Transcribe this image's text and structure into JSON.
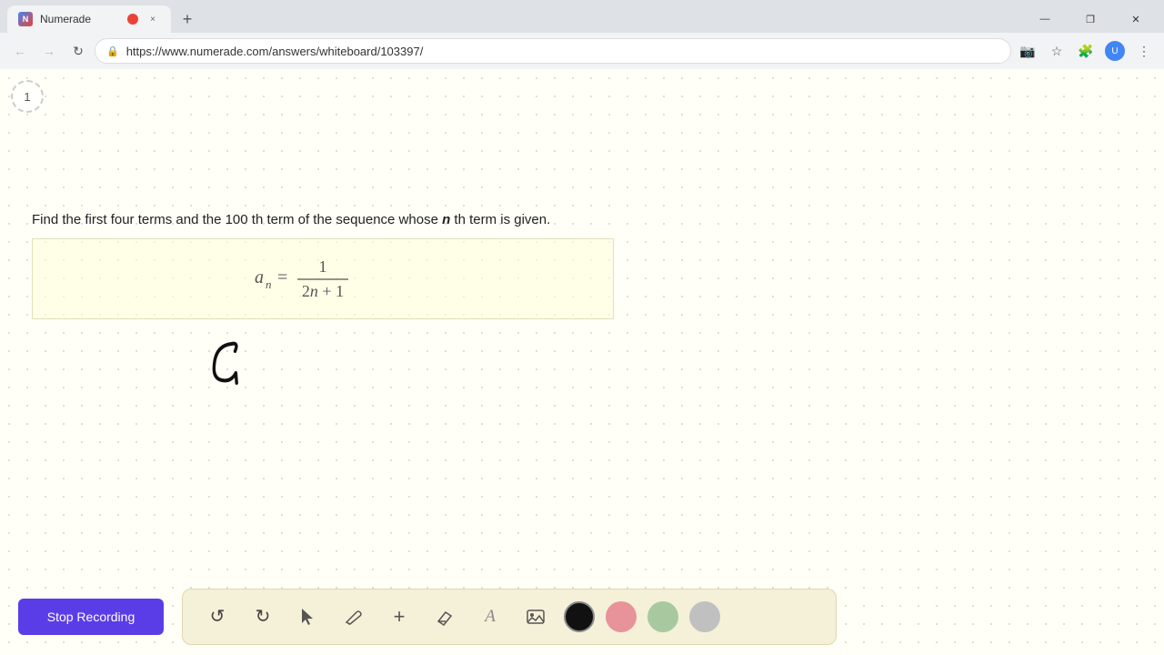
{
  "browser": {
    "tab_title": "Numerade",
    "url": "https://www.numerade.com/answers/whiteboard/103397/",
    "tab_close_label": "×",
    "tab_new_label": "+"
  },
  "nav": {
    "back_icon": "←",
    "forward_icon": "→",
    "reload_icon": "↻",
    "lock_icon": "🔒",
    "star_icon": "☆",
    "menu_icon": "⋮"
  },
  "page": {
    "step_number": "1",
    "question_text_1": "Find the first four terms and the 100 th term of the sequence whose ",
    "question_italic": "n",
    "question_text_2": " th term is given.",
    "formula_label": "aₙ = 1 / (2n + 1)"
  },
  "bottom_toolbar": {
    "stop_recording_label": "Stop Recording",
    "undo_icon": "↺",
    "redo_icon": "↻",
    "cursor_icon": "▲",
    "pen_icon": "✏",
    "add_icon": "+",
    "eraser_icon": "◫",
    "text_icon": "A",
    "image_icon": "🖼",
    "colors": [
      {
        "name": "black",
        "hex": "#111111"
      },
      {
        "name": "pink",
        "hex": "#e8929a"
      },
      {
        "name": "green",
        "hex": "#a8c8a0"
      },
      {
        "name": "gray",
        "hex": "#c0c0c0"
      }
    ]
  },
  "window_controls": {
    "minimize": "—",
    "maximize": "❐",
    "close": "✕"
  }
}
